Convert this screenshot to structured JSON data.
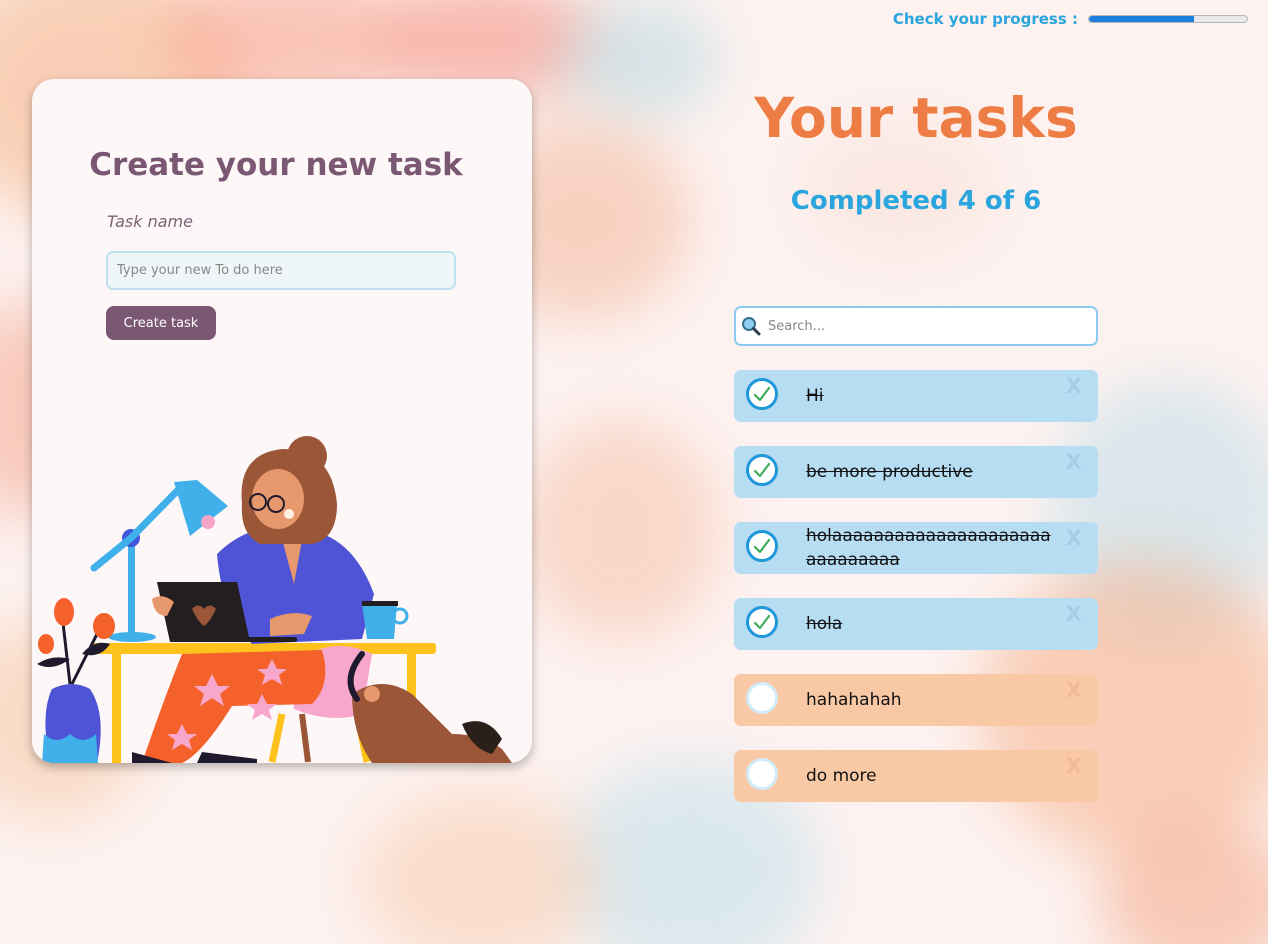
{
  "progress": {
    "label": "Check your progress :",
    "completed": 4,
    "total": 6,
    "accent_color": "#1e7fe0"
  },
  "create_card": {
    "title": "Create your new task",
    "task_name_label": "Task name",
    "input_placeholder": "Type your new To do here",
    "input_value": "",
    "create_button_label": "Create task",
    "illustration_icon": "woman-working-at-desk-illustration"
  },
  "tasks_panel": {
    "heading": "Your tasks",
    "completed_text": "Completed 4 of 6",
    "search": {
      "placeholder": "Search...",
      "value": "",
      "icon": "search-icon"
    },
    "delete_label": "X",
    "items": [
      {
        "text": "Hi",
        "completed": true
      },
      {
        "text": "be more productive",
        "completed": true
      },
      {
        "text": "holaaaaaaaaaaaaaaaaaaaaaaaaaaaaaa",
        "completed": true
      },
      {
        "text": "hola",
        "completed": true
      },
      {
        "text": "hahahahah",
        "completed": false
      },
      {
        "text": "do more",
        "completed": false
      }
    ]
  },
  "colors": {
    "card_title": "#7a5873",
    "button": "#7a5873",
    "heading": "#ee7d45",
    "completed_text": "#2aa5dd",
    "task_done_bg": "#b7ddf3",
    "task_todo_bg": "#f9c9a5"
  }
}
